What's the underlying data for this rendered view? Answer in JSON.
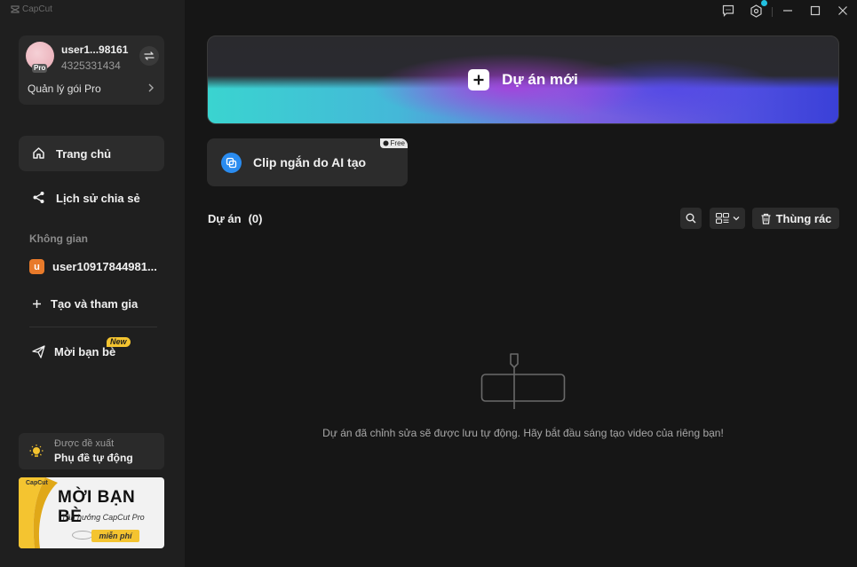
{
  "app": {
    "brand": "CapCut"
  },
  "user": {
    "name": "user1...98161",
    "id": "4325331434",
    "badge": "Pro",
    "plan_link": "Quản lý gói Pro"
  },
  "nav": {
    "home": "Trang chủ",
    "share_history": "Lịch sử chia sẻ"
  },
  "workspace": {
    "title": "Không gian",
    "badge_letter": "u",
    "name": "user10917844981...",
    "create_join": "Tạo và tham gia"
  },
  "invite": {
    "label": "Mời bạn bè",
    "badge": "New"
  },
  "suggestion": {
    "caption": "Được đề xuất",
    "title": "Phụ đề tự động"
  },
  "promo": {
    "brand": "CapCut",
    "title": "MỜI BẠN BÈ",
    "subtitle": "Tận hưởng CapCut Pro",
    "tag": "miễn phí"
  },
  "hero": {
    "label": "Dự án mới"
  },
  "ai_card": {
    "label": "Clip ngắn do AI tạo",
    "badge": "Free"
  },
  "projects": {
    "title": "Dự án",
    "count": "(0)",
    "trash": "Thùng rác",
    "empty_message": "Dự án đã chỉnh sửa sẽ được lưu tự động. Hãy bắt đầu sáng tạo video của riêng bạn!"
  },
  "colors": {
    "accent_blue": "#2a8cf0",
    "workspace_orange": "#e87a2a",
    "badge_yellow": "#f4c430",
    "notification_dot": "#22c0e0"
  }
}
